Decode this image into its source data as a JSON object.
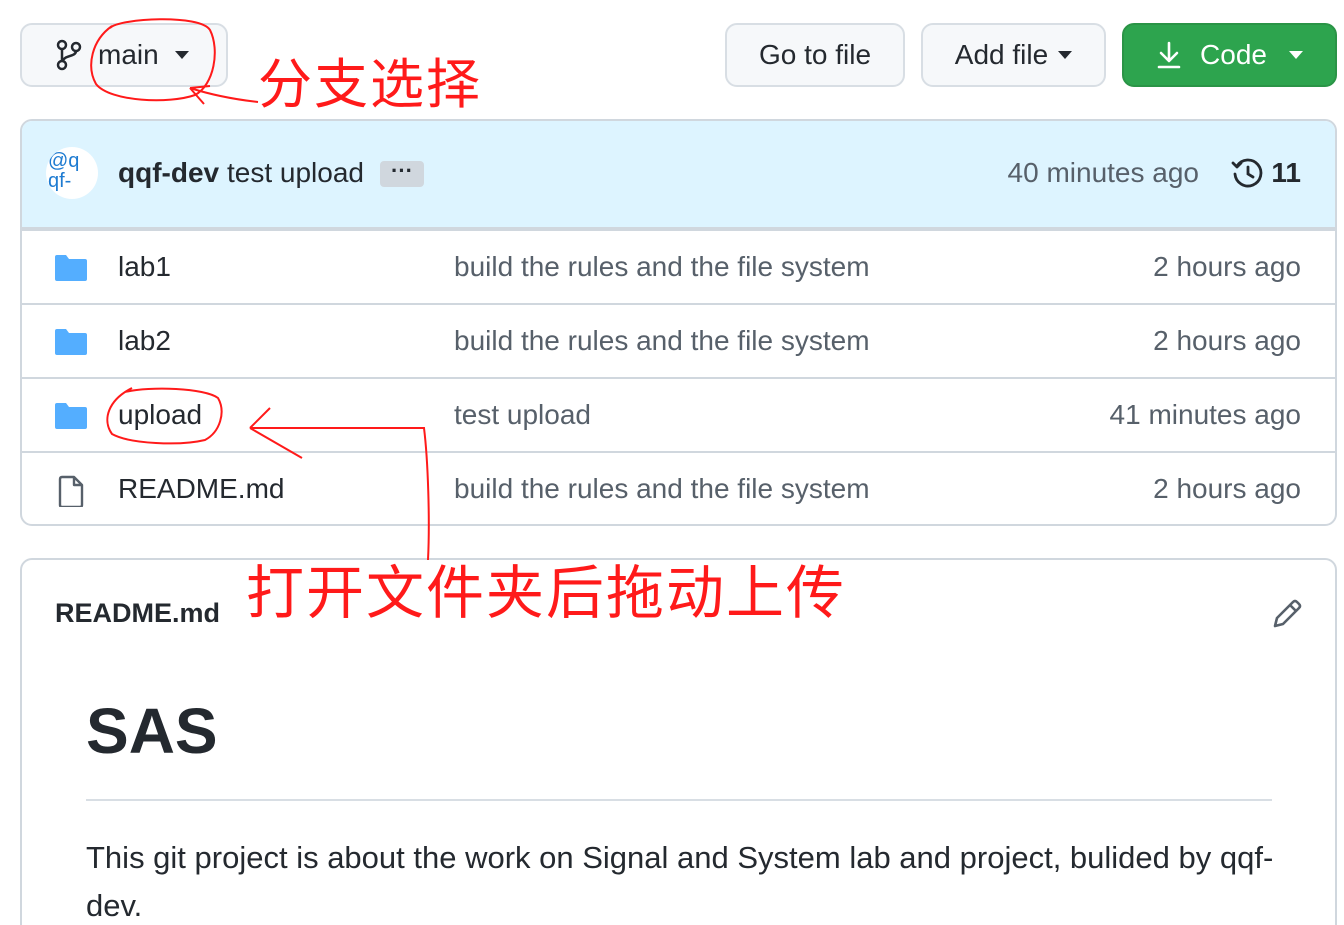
{
  "toolbar": {
    "branch_label": "main",
    "goto_label": "Go to file",
    "addfile_label": "Add file",
    "code_label": "Code"
  },
  "commit": {
    "avatar_text": "@q\nqf-",
    "author": "qqf-dev",
    "message": "test upload",
    "ellipsis": "···",
    "time": "40 minutes ago",
    "count": "11"
  },
  "files": [
    {
      "name": "lab1",
      "type": "folder",
      "message": "build the rules and the file system",
      "time": "2 hours ago"
    },
    {
      "name": "lab2",
      "type": "folder",
      "message": "build the rules and the file system",
      "time": "2 hours ago"
    },
    {
      "name": "upload",
      "type": "folder",
      "message": "test upload",
      "time": "41 minutes ago"
    },
    {
      "name": "README.md",
      "type": "file",
      "message": "build the rules and the file system",
      "time": "2 hours ago"
    }
  ],
  "readme": {
    "title": "README.md",
    "h1": "SAS",
    "paragraph": "This git project is about the work on Signal and System lab and project, bulided by qqf-dev."
  },
  "annotations": {
    "branch_note": "分支选择",
    "upload_note": "打开文件夹后拖动上传",
    "color": "#ff1a1a"
  },
  "colors": {
    "code_button": "#2da44e",
    "commit_bar": "#ddf4ff",
    "folder_icon": "#54aeff"
  }
}
